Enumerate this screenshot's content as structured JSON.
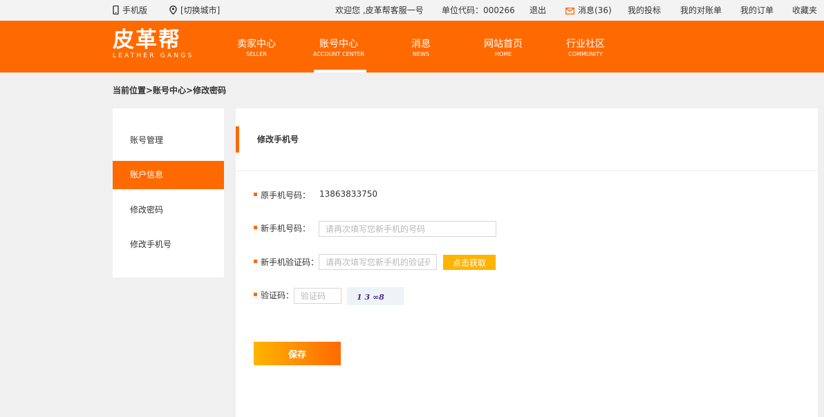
{
  "topbar": {
    "mobile": "手机版",
    "city": "[切换城市]",
    "welcome": "欢迎您 ,皮革帮客服一号",
    "unit_code": "单位代码：000266",
    "logout": "退出",
    "messages": "消息(36)",
    "complaints": "我的投标",
    "statements": "我的对账单",
    "orders": "我的订单",
    "favorites": "收藏夹"
  },
  "logo": {
    "cn": "皮革帮",
    "en": "LEATHER GANGS"
  },
  "nav": [
    {
      "cn": "卖家中心",
      "en": "SELLER"
    },
    {
      "cn": "账号中心",
      "en": "ACCOUNT CENTER"
    },
    {
      "cn": "消息",
      "en": "NEWS"
    },
    {
      "cn": "网站首页",
      "en": "HOME"
    },
    {
      "cn": "行业社区",
      "en": "COMMUNITY"
    }
  ],
  "breadcrumb": "当前位置>账号中心>修改密码",
  "sidebar": [
    {
      "label": "账号管理"
    },
    {
      "label": "账户信息"
    },
    {
      "label": "修改密码"
    },
    {
      "label": "修改手机号"
    }
  ],
  "main": {
    "title": "修改手机号",
    "old_phone_label": "原手机号码：",
    "old_phone_value": "13863833750",
    "new_phone_label": "新手机号码：",
    "new_phone_placeholder": "请再次填写您新手机的号码",
    "new_code_label": "新手机验证码：",
    "new_code_placeholder": "请再次填写您新手机的验证码",
    "get_code_button": "点击获取",
    "captcha_label": "验证码：",
    "captcha_placeholder": "验证码",
    "captcha_text": "1 3 ∞8",
    "save_button": "保存"
  },
  "colors": {
    "accent": "#ff6a00",
    "button_yellow": "#ffb400"
  }
}
